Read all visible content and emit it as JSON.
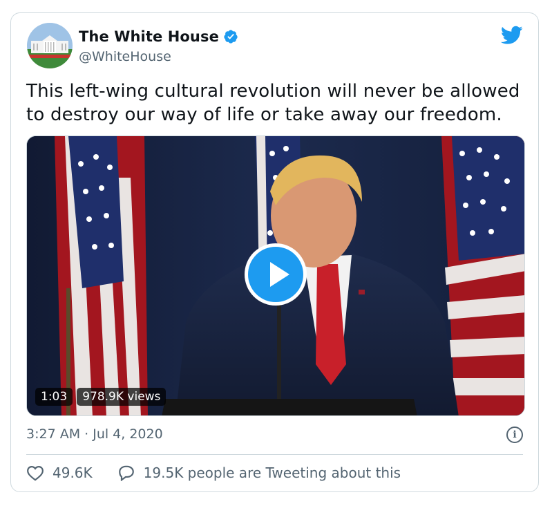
{
  "author": {
    "display_name": "The White House",
    "handle": "@WhiteHouse",
    "verified": true
  },
  "tweet": {
    "text": "This left-wing cultural revolution will never be allowed to destroy our way of life or take away our freedom.",
    "timestamp": "3:27 AM · Jul 4, 2020"
  },
  "video": {
    "duration": "1:03",
    "views": "978.9K views"
  },
  "stats": {
    "likes": "49.6K",
    "conversation": "19.5K people are Tweeting about this"
  },
  "icons": {
    "brand": "twitter-bird-icon",
    "verified": "verified-badge-icon",
    "play": "play-icon",
    "info": "info-icon",
    "like": "heart-icon",
    "reply": "speech-bubble-icon"
  },
  "colors": {
    "accent": "#1d9bf0",
    "text": "#0f1419",
    "muted": "#536471",
    "border": "#cfd9de"
  }
}
